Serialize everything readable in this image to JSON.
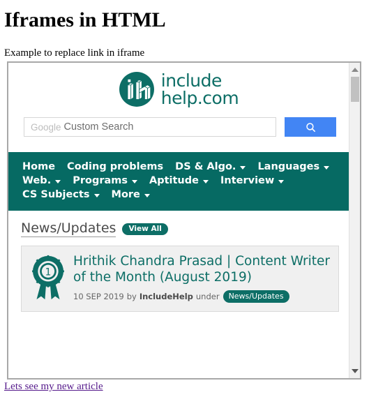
{
  "host_page": {
    "title": "Iframes in HTML",
    "description": "Example to replace link in iframe",
    "bottom_link": "Lets see my new article"
  },
  "colors": {
    "brand_teal": "#0d6e66",
    "nav_teal": "#066a63",
    "search_button_blue": "#4285f4",
    "visited_link_purple": "#551a8b",
    "card_background": "#f0f0f0",
    "iframe_border": "#a8a8a8",
    "scrollbar_track": "#f1f1f1",
    "scrollbar_thumb": "#c1c1c1"
  },
  "iframe": {
    "logo": {
      "icon": "includehelp-logo-icon",
      "line1": "include",
      "line2": "help.com"
    },
    "search": {
      "brand_label": "Google",
      "placeholder": "Custom Search",
      "value": "",
      "button_icon": "search-icon"
    },
    "nav": {
      "rows": [
        [
          {
            "label": "Home",
            "caret": false
          },
          {
            "label": "Coding problems",
            "caret": false
          },
          {
            "label": "DS & Algo.",
            "caret": true
          },
          {
            "label": "Languages",
            "caret": true
          }
        ],
        [
          {
            "label": "Web.",
            "caret": true
          },
          {
            "label": "Programs",
            "caret": true
          },
          {
            "label": "Aptitude",
            "caret": true
          },
          {
            "label": "Interview",
            "caret": true
          }
        ],
        [
          {
            "label": "CS Subjects",
            "caret": true
          },
          {
            "label": "More",
            "caret": true
          }
        ]
      ]
    },
    "news": {
      "heading": "News/Updates",
      "view_all": "View All",
      "article": {
        "icon": "award-ribbon-icon",
        "badge_number": "1",
        "title": "Hrithik Chandra Prasad | Content Writer of the Month (August 2019)",
        "date": "10 SEP 2019",
        "by_label": "by",
        "author": "IncludeHelp",
        "under_label": "under",
        "tag": "News/Updates"
      }
    },
    "scrollbar": {
      "up_icon": "triangle-up-icon",
      "down_icon": "triangle-down-icon",
      "thumb": "scrollbar-thumb"
    }
  }
}
